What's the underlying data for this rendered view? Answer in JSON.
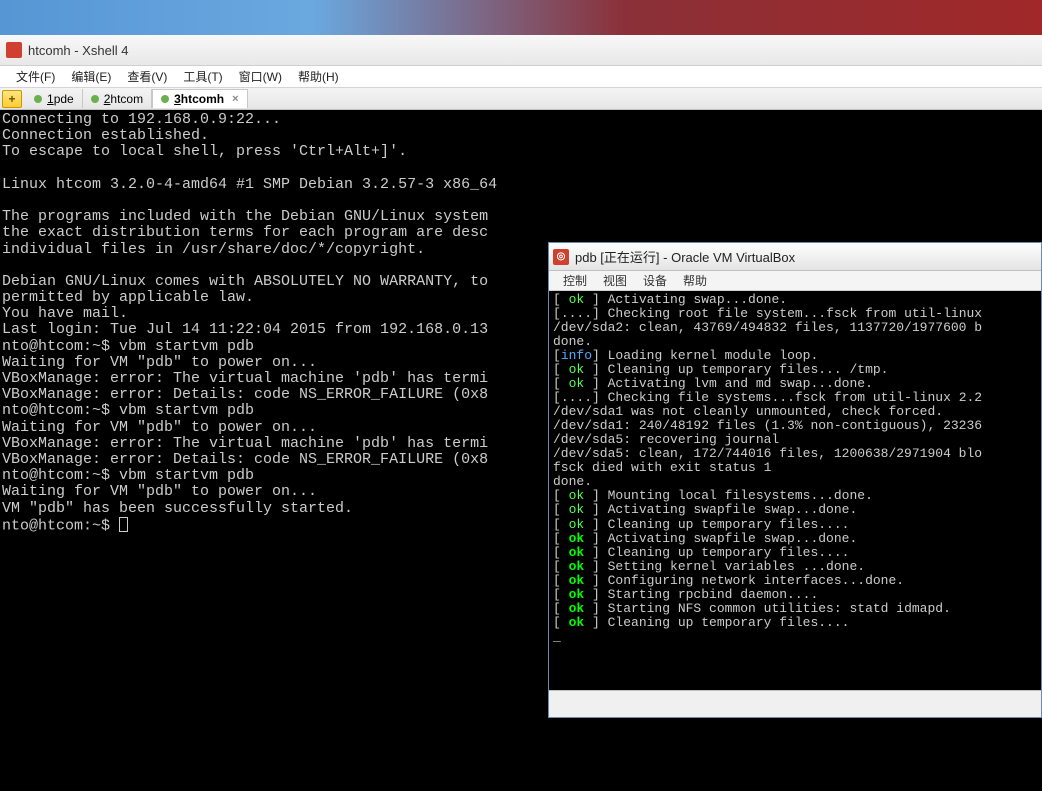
{
  "xshell": {
    "title": "htcomh - Xshell 4",
    "menu": [
      "文件(F)",
      "编辑(E)",
      "查看(V)",
      "工具(T)",
      "窗口(W)",
      "帮助(H)"
    ],
    "add_btn": "+",
    "tabs": [
      {
        "num": "1",
        "label": "pde"
      },
      {
        "num": "2",
        "label": "htcom"
      },
      {
        "num": "3",
        "label": "htcomh"
      }
    ],
    "terminal_lines": [
      "Connecting to 192.168.0.9:22...",
      "Connection established.",
      "To escape to local shell, press 'Ctrl+Alt+]'.",
      "",
      "Linux htcom 3.2.0-4-amd64 #1 SMP Debian 3.2.57-3 x86_64",
      "",
      "The programs included with the Debian GNU/Linux system",
      "the exact distribution terms for each program are desc",
      "individual files in /usr/share/doc/*/copyright.",
      "",
      "Debian GNU/Linux comes with ABSOLUTELY NO WARRANTY, to",
      "permitted by applicable law.",
      "You have mail.",
      "Last login: Tue Jul 14 11:22:04 2015 from 192.168.0.13",
      "nto@htcom:~$ vbm startvm pdb",
      "Waiting for VM \"pdb\" to power on...",
      "VBoxManage: error: The virtual machine 'pdb' has termi",
      "VBoxManage: error: Details: code NS_ERROR_FAILURE (0x8",
      "nto@htcom:~$ vbm startvm pdb",
      "Waiting for VM \"pdb\" to power on...",
      "VBoxManage: error: The virtual machine 'pdb' has termi",
      "VBoxManage: error: Details: code NS_ERROR_FAILURE (0x8",
      "nto@htcom:~$ vbm startvm pdb",
      "Waiting for VM \"pdb\" to power on...",
      "VM \"pdb\" has been successfully started."
    ],
    "prompt": "nto@htcom:~$ "
  },
  "vbox": {
    "title": "pdb [正在运行] - Oracle VM VirtualBox",
    "menu": [
      "控制",
      "视图",
      "设备",
      "帮助"
    ],
    "lines": [
      {
        "tag": "ok",
        "text": "Activating swap...done."
      },
      {
        "tag": "....",
        "text": "Checking root file system...fsck from util-linux"
      },
      {
        "raw": "/dev/sda2: clean, 43769/494832 files, 1137720/1977600 b"
      },
      {
        "raw": "done."
      },
      {
        "tag": "info",
        "text": "Loading kernel module loop."
      },
      {
        "tag": "ok",
        "text": "Cleaning up temporary files... /tmp."
      },
      {
        "tag": "ok",
        "text": "Activating lvm and md swap...done."
      },
      {
        "tag": "....",
        "text": "Checking file systems...fsck from util-linux 2.2"
      },
      {
        "raw": "/dev/sda1 was not cleanly unmounted, check forced."
      },
      {
        "raw": "/dev/sda1: 240/48192 files (1.3% non-contiguous), 23236"
      },
      {
        "raw": "/dev/sda5: recovering journal"
      },
      {
        "raw": "/dev/sda5: clean, 172/744016 files, 1200638/2971904 blo"
      },
      {
        "raw": "fsck died with exit status 1"
      },
      {
        "raw": "done."
      },
      {
        "tag": "ok",
        "text": "Mounting local filesystems...done."
      },
      {
        "tag": "ok",
        "text": "Activating swapfile swap...done."
      },
      {
        "tag": "ok",
        "text": "Cleaning up temporary files...."
      },
      {
        "tag": "okb",
        "text": "Activating swapfile swap...done."
      },
      {
        "tag": "okb",
        "text": "Cleaning up temporary files...."
      },
      {
        "tag": "okb",
        "text": "Setting kernel variables ...done."
      },
      {
        "tag": "okb",
        "text": "Configuring network interfaces...done."
      },
      {
        "tag": "okb",
        "text": "Starting rpcbind daemon...."
      },
      {
        "tag": "okb",
        "text": "Starting NFS common utilities: statd idmapd."
      },
      {
        "tag": "okb",
        "text": "Cleaning up temporary files...."
      }
    ]
  }
}
